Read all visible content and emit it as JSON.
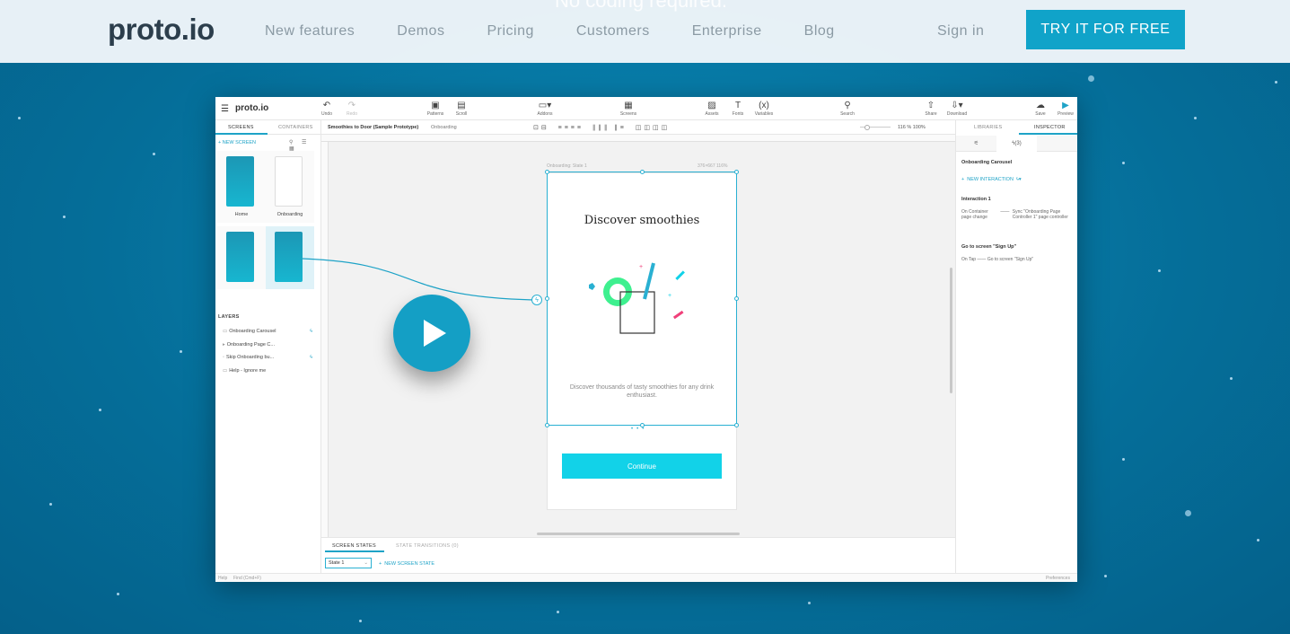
{
  "hero": {
    "ghost_text": "No coding required."
  },
  "nav": {
    "logo": "proto.io",
    "links": [
      "New features",
      "Demos",
      "Pricing",
      "Customers",
      "Enterprise",
      "Blog"
    ],
    "sign_in": "Sign in",
    "cta": "TRY IT FOR FREE"
  },
  "app": {
    "logo": "proto.io",
    "toolbar": {
      "undo": "Undo",
      "redo": "Redo",
      "patterns": "Patterns",
      "scroll": "Scroll",
      "addons": "Addons",
      "screens": "Screens",
      "assets": "Assets",
      "fonts": "Fonts",
      "variables": "Variables",
      "search": "Search",
      "share": "Share",
      "download": "Download",
      "save": "Save",
      "preview": "Preview"
    },
    "project": "Smoothies to Door (Sample Prototype)",
    "current_screen": "Onboarding",
    "zoom": {
      "value": "116",
      "unit": "%",
      "fit": "100%"
    },
    "left": {
      "tabs": [
        "SCREENS",
        "CONTAINERS"
      ],
      "new_screen": "NEW SCREEN",
      "screens": [
        {
          "label": "Home"
        },
        {
          "label": "Onboarding"
        },
        {
          "label": ""
        },
        {
          "label": ""
        }
      ],
      "layers_header": "LAYERS",
      "layers": [
        "Onboarding Carousel",
        "Onboarding Page C...",
        "Skip Onboarding bu...",
        "Help - Ignore me"
      ]
    },
    "canvas": {
      "state_label": "Onboarding: State 1",
      "size_label": "376×667",
      "zoom_label": "116%",
      "headline": "Discover smoothies",
      "description": "Discover thousands of tasty smoothies for any drink enthusiast.",
      "continue": "Continue"
    },
    "bottom": {
      "tabs": [
        "SCREEN STATES",
        "STATE TRANSITIONS (0)"
      ],
      "state": "State 1",
      "new_state": "NEW SCREEN STATE"
    },
    "right": {
      "tabs": [
        "LIBRARIES",
        "INSPECTOR"
      ],
      "interactions_tab": "(3)",
      "selected": "Onboarding Carousel",
      "new_interaction": "NEW INTERACTION",
      "interaction_title": "Interaction 1",
      "trigger": "On Container page change",
      "action": "Sync \"Onboarding Page Controller 1\" page controller",
      "goto_title": "Go to screen \"Sign Up\"",
      "goto_trigger": "On Tap",
      "goto_action": "Go to screen \"Sign Up\""
    },
    "status": {
      "help": "Help",
      "find": "Find (Cmd+F)",
      "preferences": "Preferences"
    }
  },
  "colors": {
    "accent": "#1ea3c7",
    "cta": "#10a3c9",
    "continue": "#12d2e8",
    "background": "#056e99"
  }
}
